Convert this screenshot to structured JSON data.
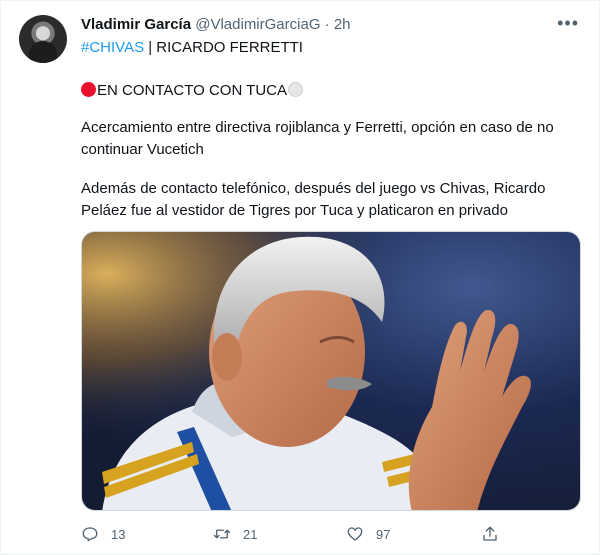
{
  "author": {
    "name": "Vladimir García",
    "handle": "@VladimirGarciaG",
    "separator": "·",
    "time": "2h"
  },
  "more_icon": "more-options-icon",
  "text": {
    "hashtag": "#CHIVAS",
    "headline_rest": " | RICARDO FERRETTI",
    "contact_line": "EN CONTACTO CON TUCA",
    "paragraph1": "Acercamiento entre directiva rojiblanca y Ferretti, opción en caso de no continuar Vucetich",
    "paragraph2": "Además de contacto telefónico, después del juego vs Chivas, Ricardo Peláez fue al vestidor de Tigres por Tuca y platicaron en privado"
  },
  "emoji": {
    "red": "red-circle",
    "white": "white-circle"
  },
  "actions": {
    "reply_count": "13",
    "retweet_count": "21",
    "like_count": "97",
    "share_count": ""
  },
  "colors": {
    "link": "#1d9bf0",
    "muted": "#536471",
    "text": "#0f1419"
  }
}
